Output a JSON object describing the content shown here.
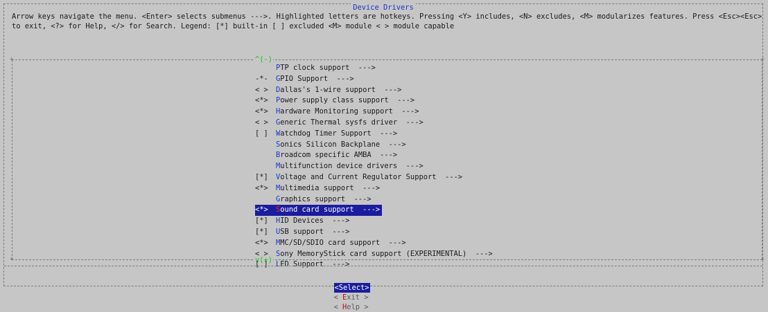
{
  "title": "Device Drivers",
  "help_text": "Arrow keys navigate the menu.  <Enter> selects submenus --->.  Highlighted letters are hotkeys.  Pressing <Y> includes, <N> excludes, <M> modularizes features.  Press <Esc><Esc> to exit, <?> for Help, </> for Search.  Legend: [*] built-in  [ ] excluded  <M> module  < > module capable",
  "scroll_up": "^(-)",
  "scroll_down": "v(+)",
  "menu": {
    "selected_index": 13,
    "items": [
      {
        "mark": "",
        "hotkey": "P",
        "rest": "TP clock support  --->"
      },
      {
        "mark": "-*-",
        "hotkey": "G",
        "rest": "PIO Support  --->"
      },
      {
        "mark": "< >",
        "hotkey": "D",
        "rest": "allas's 1-wire support  --->"
      },
      {
        "mark": "<*>",
        "hotkey": "P",
        "rest": "ower supply class support  --->"
      },
      {
        "mark": "<*>",
        "hotkey": "H",
        "rest": "ardware Monitoring support  --->"
      },
      {
        "mark": "< >",
        "hotkey": "G",
        "rest": "eneric Thermal sysfs driver  --->"
      },
      {
        "mark": "[ ]",
        "hotkey": "W",
        "rest": "atchdog Timer Support  --->"
      },
      {
        "mark": "",
        "hotkey": "S",
        "rest": "onics Silicon Backplane  --->"
      },
      {
        "mark": "",
        "hotkey": "B",
        "rest": "roadcom specific AMBA  --->"
      },
      {
        "mark": "",
        "hotkey": "M",
        "rest": "ultifunction device drivers  --->"
      },
      {
        "mark": "[*]",
        "hotkey": "V",
        "rest": "oltage and Current Regulator Support  --->"
      },
      {
        "mark": "<*>",
        "hotkey": "M",
        "rest": "ultimedia support  --->"
      },
      {
        "mark": "",
        "hotkey": "G",
        "rest": "raphics support  --->"
      },
      {
        "mark": "<*>",
        "hotkey": "S",
        "rest": "ound card support  --->"
      },
      {
        "mark": "[*]",
        "hotkey": "H",
        "rest": "ID Devices  --->"
      },
      {
        "mark": "[*]",
        "hotkey": "U",
        "rest": "SB support  --->"
      },
      {
        "mark": "<*>",
        "hotkey": "M",
        "rest": "MC/SD/SDIO card support  --->"
      },
      {
        "mark": "< >",
        "hotkey": "S",
        "rest": "ony MemoryStick card support (EXPERIMENTAL)  --->"
      },
      {
        "mark": "[ ]",
        "hotkey": "L",
        "rest": "ED Support  --->"
      }
    ]
  },
  "buttons": {
    "select": "<Select>",
    "exit_left": "< ",
    "exit_hot": "E",
    "exit_rest": "xit >",
    "help_left": "< ",
    "help_hot": "H",
    "help_rest": "elp >"
  },
  "colors": {
    "background": "#c6c6c6",
    "hotkey": "#1e35c8",
    "selection": "#1b1d9e",
    "scroll_indicator": "#18c018"
  }
}
